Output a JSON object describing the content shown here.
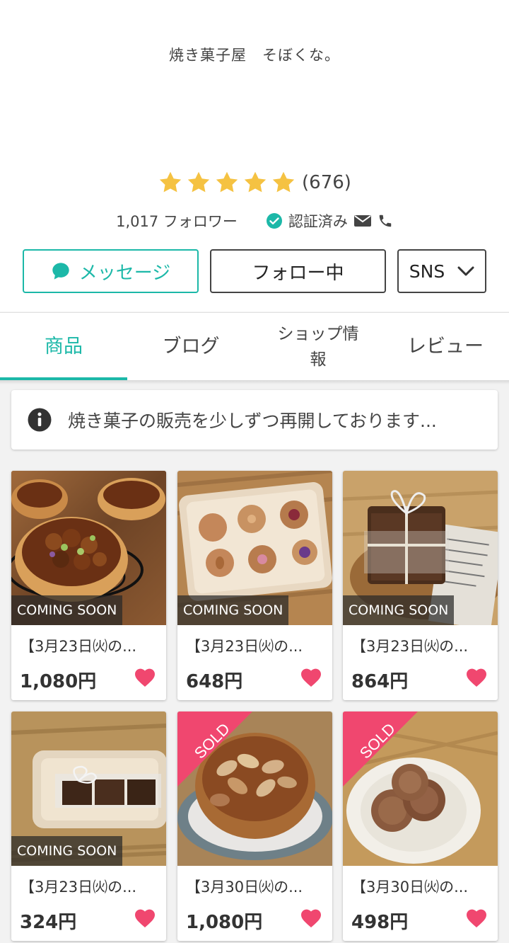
{
  "shop": {
    "name": "焼き菓子屋　そぼくな。",
    "rating_count": "(676)",
    "rating_stars": 5,
    "followers": "1,017 フォロワー",
    "verified": "認証済み"
  },
  "buttons": {
    "message": "メッセージ",
    "follow": "フォロー中",
    "sns": "SNS"
  },
  "tabs": [
    {
      "label": "商品"
    },
    {
      "label": "ブログ"
    },
    {
      "label": "ショップ情報",
      "line1": "ショップ情",
      "line2": "報"
    },
    {
      "label": "レビュー"
    }
  ],
  "notice": {
    "text": "焼き菓子の販売を少しずつ再開しております..."
  },
  "products": [
    {
      "title": "【3月23日㈫の...",
      "price": "1,080円",
      "badge": "COMING SOON"
    },
    {
      "title": "【3月23日㈫の...",
      "price": "648円",
      "badge": "COMING SOON"
    },
    {
      "title": "【3月23日㈫の...",
      "price": "864円",
      "badge": "COMING SOON"
    },
    {
      "title": "【3月23日㈫の...",
      "price": "324円",
      "badge": "COMING SOON"
    },
    {
      "title": "【3月30日㈫の...",
      "price": "1,080円",
      "badge": "SOLD"
    },
    {
      "title": "【3月30日㈫の...",
      "price": "498円",
      "badge": "SOLD"
    }
  ],
  "colors": {
    "accent": "#1cb8a8",
    "star": "#f5c242",
    "heart": "#f0476f",
    "sold": "#f0476f"
  },
  "icons": {
    "star": "star-icon",
    "message": "chat-bubble-icon",
    "verified": "check-circle-icon",
    "mail": "mail-icon",
    "phone": "phone-icon",
    "sns_dropdown": "chevron-down-icon",
    "notice": "info-icon",
    "favorite": "heart-icon"
  }
}
